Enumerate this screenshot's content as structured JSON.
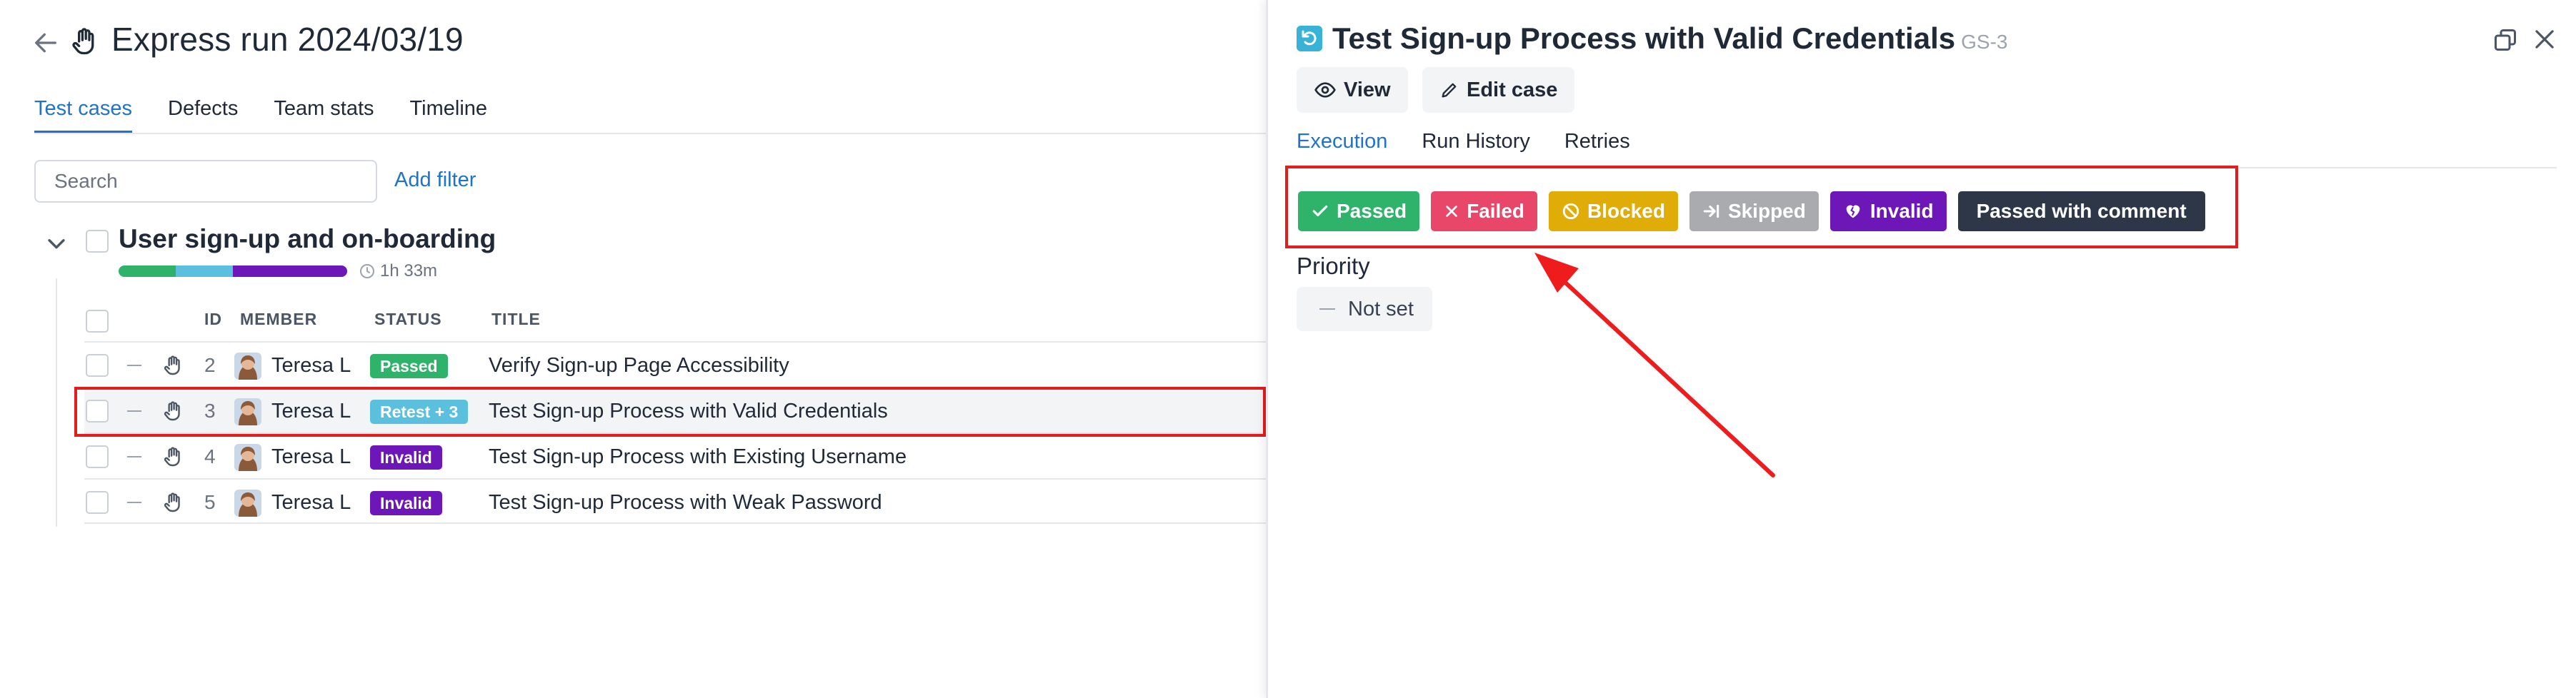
{
  "run": {
    "title": "Express run 2024/03/19"
  },
  "tabs": [
    "Test cases",
    "Defects",
    "Team stats",
    "Timeline"
  ],
  "search": {
    "placeholder": "Search"
  },
  "filter": {
    "add_label": "Add filter"
  },
  "group": {
    "title": "User sign-up and on-boarding",
    "duration": "1h 33m",
    "progress_segments": [
      {
        "color": "#2fb36a",
        "fraction": 0.25
      },
      {
        "color": "#5bc0de",
        "fraction": 0.25
      },
      {
        "color": "#6d17b8",
        "fraction": 0.5
      }
    ]
  },
  "table": {
    "columns": {
      "id": "ID",
      "member": "MEMBER",
      "status": "STATUS",
      "title": "TITLE"
    },
    "rows": [
      {
        "id": "2",
        "member": "Teresa L",
        "status": "Passed",
        "status_color": "#2fb36a",
        "title": "Verify Sign-up Page Accessibility"
      },
      {
        "id": "3",
        "member": "Teresa L",
        "status": "Retest + 3",
        "status_color": "#5bc0de",
        "title": "Test Sign-up Process with Valid Credentials"
      },
      {
        "id": "4",
        "member": "Teresa L",
        "status": "Invalid",
        "status_color": "#6d17b8",
        "title": "Test Sign-up Process with Existing Username"
      },
      {
        "id": "5",
        "member": "Teresa L",
        "status": "Invalid",
        "status_color": "#6d17b8",
        "title": "Test Sign-up Process with Weak Password"
      }
    ]
  },
  "panel": {
    "title": "Test Sign-up Process with Valid Credentials",
    "code": "GS-3",
    "view_label": "View",
    "edit_label": "Edit case",
    "tabs": [
      "Execution",
      "Run History",
      "Retries"
    ],
    "statuses": [
      {
        "label": "Passed",
        "color": "#2fb36a",
        "icon": "check-icon"
      },
      {
        "label": "Failed",
        "color": "#e8476a",
        "icon": "x-icon"
      },
      {
        "label": "Blocked",
        "color": "#e0ac08",
        "icon": "ban-icon"
      },
      {
        "label": "Skipped",
        "color": "#a9abae",
        "icon": "skip-icon"
      },
      {
        "label": "Invalid",
        "color": "#6d17b8",
        "icon": "broken-heart-icon"
      },
      {
        "label": "Passed with comment",
        "color": "#2d3748",
        "icon": ""
      }
    ],
    "priority_label": "Priority",
    "priority_value": "Not set"
  },
  "colors": {
    "accent": "#1f73c8",
    "highlight": "#e11d1d"
  }
}
